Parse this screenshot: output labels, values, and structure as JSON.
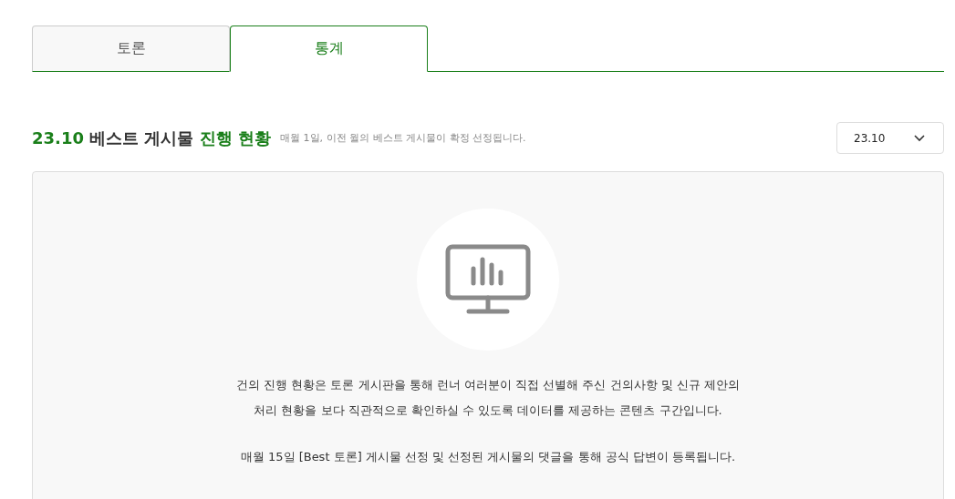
{
  "tabs": [
    {
      "label": "토론",
      "selected": false
    },
    {
      "label": "통계",
      "selected": true
    }
  ],
  "section": {
    "title": [
      {
        "text": "23.10",
        "highlight": true
      },
      {
        "text": " 베스트 게시물 ",
        "highlight": false
      },
      {
        "text": "진행 현황",
        "highlight": true
      }
    ],
    "note": "매월 1일, 이전 월의 베스트 게시물이 확정 선정됩니다.",
    "month_select": {
      "value": "23.10"
    }
  },
  "panel": {
    "paragraphs": [
      [
        "건의 진행 현황은 토론 게시판을 통해 런너 여러분이 직접 선별해 주신 건의사항 및 신규 제안의",
        "처리 현황을 보다 직관적으로 확인하실 수 있도록 데이터를 제공하는 콘텐츠 구간입니다."
      ],
      [
        "매월 15일 [Best 토론] 게시물 선정 및 선정된 게시물의 댓글을 통해 공식 답변이 등록됩니다."
      ]
    ]
  }
}
